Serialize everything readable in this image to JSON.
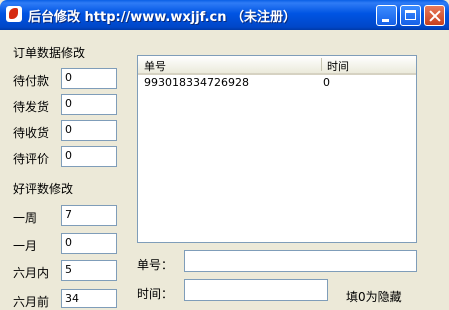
{
  "window": {
    "title": "后台修改  http://www.wxjjf.cn （未注册）"
  },
  "order_group": {
    "heading": "订单数据修改",
    "fields": [
      {
        "label": "待付款",
        "value": "0"
      },
      {
        "label": "待发货",
        "value": "0"
      },
      {
        "label": "待收货",
        "value": "0"
      },
      {
        "label": "待评价",
        "value": "0"
      }
    ]
  },
  "review_group": {
    "heading": "好评数修改",
    "fields": [
      {
        "label": "一周",
        "value": "7"
      },
      {
        "label": "一月",
        "value": "0"
      },
      {
        "label": "六月内",
        "value": "5"
      },
      {
        "label": "六月前",
        "value": "34"
      }
    ]
  },
  "list": {
    "columns": [
      "单号",
      "时间"
    ],
    "rows": [
      {
        "order_no": "993018334726928",
        "time": "0"
      }
    ]
  },
  "edit": {
    "order_label": "单号：",
    "order_value": "",
    "time_label": "时间：",
    "time_value": "",
    "hint": "填0为隐藏"
  }
}
